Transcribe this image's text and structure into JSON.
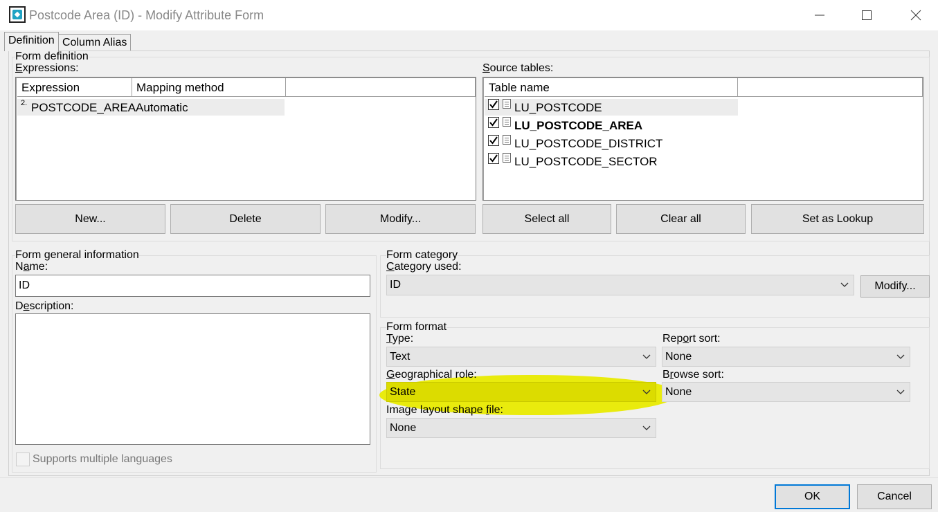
{
  "window": {
    "title": "Postcode Area (ID) - Modify Attribute Form"
  },
  "tabs": [
    {
      "label": "Definition"
    },
    {
      "label": "Column Alias"
    }
  ],
  "form_definition": {
    "group_label": "Form definition",
    "expressions_label": "Expressions:",
    "expr_columns": [
      "Expression",
      "Mapping method"
    ],
    "expr_rows": [
      {
        "index": "2.",
        "expression": "POSTCODE_AREA",
        "mapping": "Automatic"
      }
    ],
    "source_tables_label": "Source tables:",
    "table_column": "Table name",
    "tables": [
      {
        "name": "LU_POSTCODE",
        "checked": true,
        "bold": false
      },
      {
        "name": "LU_POSTCODE_AREA",
        "checked": true,
        "bold": true
      },
      {
        "name": "LU_POSTCODE_DISTRICT",
        "checked": true,
        "bold": false
      },
      {
        "name": "LU_POSTCODE_SECTOR",
        "checked": true,
        "bold": false
      }
    ],
    "buttons": {
      "new": "New...",
      "delete": "Delete",
      "modify": "Modify...",
      "select_all": "Select all",
      "clear_all": "Clear all",
      "set_lookup": "Set as Lookup"
    }
  },
  "general_info": {
    "group_label": "Form general information",
    "name_label": "Name:",
    "name_value": "ID",
    "description_label": "Description:",
    "description_value": "",
    "supports_multi_lang": "Supports multiple languages"
  },
  "category": {
    "group_label": "Form category",
    "category_used_label": "Category used:",
    "category_value": "ID",
    "modify_button": "Modify..."
  },
  "format": {
    "group_label": "Form format",
    "type_label": "Type:",
    "type_value": "Text",
    "report_sort_label": "Report sort:",
    "report_sort_value": "None",
    "geo_role_label": "Geographical role:",
    "geo_role_value": "State",
    "browse_sort_label": "Browse sort:",
    "browse_sort_value": "None",
    "image_layout_label": "Image layout shape file:",
    "image_layout_value": "None"
  },
  "footer": {
    "ok": "OK",
    "cancel": "Cancel"
  },
  "colors": {
    "highlight": "#e8ea00",
    "default_button_border": "#0078d7",
    "app_icon": "#1fa3c4"
  }
}
